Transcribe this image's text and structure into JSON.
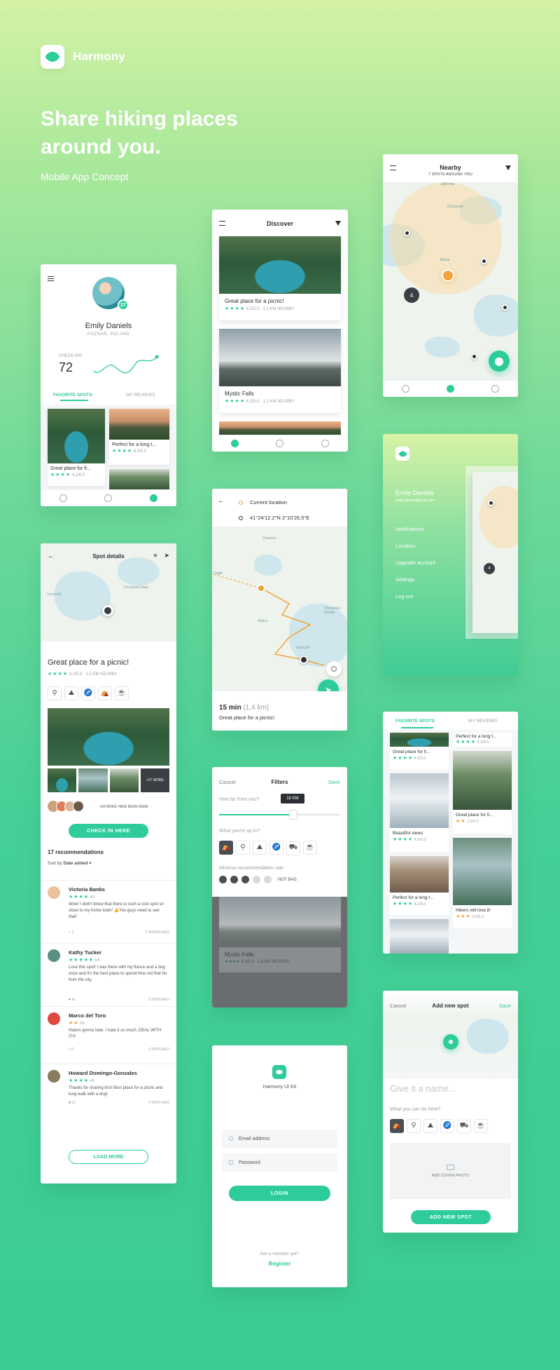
{
  "brand": {
    "name": "Harmony"
  },
  "hero": {
    "title": "Share hiking places around you.",
    "subtitle": "Mobile App Concept"
  },
  "profile": {
    "name": "Emily Daniels",
    "location": "POZNAŃ, POLAND",
    "badge": "27",
    "checkins_label": "CHECK-INS",
    "checkins": "72",
    "tabs": [
      "FAVORITE SPOTS",
      "MY REVIEWS"
    ],
    "cards": [
      {
        "title": "Great place for fi...",
        "rating": "4.2/5.0"
      },
      {
        "title": "Perfect for a long t...",
        "rating": "4.2/5.0"
      }
    ]
  },
  "discover": {
    "title": "Discover",
    "cards": [
      {
        "title": "Great place for a picnic!",
        "meta": "4.2/5.0 · 1.2 KM NEARBY"
      },
      {
        "title": "Mystic Falls",
        "meta": "4.2/5.0 · 1.2 KM NEARBY"
      }
    ]
  },
  "nearby": {
    "title": "Nearby",
    "subtitle": "7 SPOTS AROUND YOU",
    "cluster": "4",
    "places": [
      "Jabłonna",
      "Chrzanów",
      "Bielsk"
    ]
  },
  "menu": {
    "name": "Emily Daniels",
    "email": "emily.daniels@gmail.com",
    "items": [
      "Notifications",
      "Location",
      "Upgrade account",
      "Settings",
      "Log out"
    ],
    "peek_cluster": "4"
  },
  "spot": {
    "header": "Spot details",
    "title": "Great place for a picnic!",
    "meta": "4.2/5.0 · 1.5 KM NEARBY",
    "more_photos": "+27 MORE",
    "visitors": "+82 MORE HAVE BEEN HERE",
    "checkin": "CHECK IN HERE",
    "recs_title": "17 recommendations",
    "sort_label": "Sort by",
    "sort_value": "Date added",
    "reviews": [
      {
        "name": "Victoria Banks",
        "score": "4/5",
        "text": "Wow! I didn't know that there is such a cool spot so close to my home town! 👍You guys need to see that!",
        "likes": "3",
        "time": "2 HOURS AGO"
      },
      {
        "name": "Kathy Tucker",
        "score": "5/5",
        "text": "Love this spot! I was there with my fiance and a dog once and it's the best place to spend time not that far from the city.",
        "likes": "41",
        "time": "6 DAYS AGO"
      },
      {
        "name": "Marco del Toro",
        "score": "2/5",
        "text": "Haters gonna hate. I hate it so much. DEAL WITH IT!!!",
        "likes": "0",
        "time": "6 DAYS AGO"
      },
      {
        "name": "Howard Domingo-Gonzales",
        "score": "4/5",
        "text": "Thanks for sharing this! Best place for a picnic and long walk with a dog!",
        "likes": "11",
        "time": "6 DAYS AGO"
      }
    ],
    "load_more": "LOAD MORE",
    "map_labels": [
      "Łężeczki",
      "Chrzypsko Małe"
    ]
  },
  "route": {
    "from": "Current location",
    "to": "41°24'12.2\"N 2°10'26.5\"E",
    "time": "15 min",
    "distance": "(1,4 km)",
    "dest": "Great place for a picnic!",
    "map_labels": [
      "Charzice",
      "Bielcz",
      "Chrzypsko Wielkie",
      "Łężeczki",
      "Osjak"
    ]
  },
  "filters": {
    "cancel": "Cancel",
    "title": "Filters",
    "save": "Save",
    "distance_label": "How far from you?",
    "distance_value": "15 KM",
    "activity_label": "What you're up to?",
    "rate_label": "Minimal recommendation rate",
    "rate_value": "NOT BAD.",
    "bg_card_title": "Mystic Falls",
    "bg_card_meta": "4.2/5.0 · 1.2 KM NEARBY"
  },
  "favorites": {
    "tabs": [
      "FAVORITE SPOTS",
      "MY REVIEWS"
    ],
    "col1": [
      {
        "title": "Great place for fi...",
        "rating": "4.2/5.0"
      },
      {
        "title": "Beautiful views",
        "rating": "4.9/5.0"
      },
      {
        "title": "Perfect for a long t...",
        "rating": "4.2/5.0"
      }
    ],
    "col2": [
      {
        "title": "Perfect for a long t...",
        "rating": "4.2/5.0"
      },
      {
        "title": "Great place for fi...",
        "rating": "2.2/5.0"
      },
      {
        "title": "Hikers will love it!",
        "rating": "3.6/5.0"
      }
    ]
  },
  "login": {
    "app": "Harmony UI Kit",
    "email": "Email address",
    "password": "Password",
    "button": "LOGIN",
    "prompt": "Not a member yet?",
    "register": "Register"
  },
  "addspot": {
    "cancel": "Cancel",
    "title": "Add new spot",
    "save": "Save",
    "name_placeholder": "Give it a name...",
    "activity_label": "What you can do here?",
    "cover": "ADD COVER PHOTO",
    "button": "ADD NEW SPOT"
  },
  "colors": {
    "accent": "#2ecc9a",
    "orange": "#f0a33b"
  }
}
